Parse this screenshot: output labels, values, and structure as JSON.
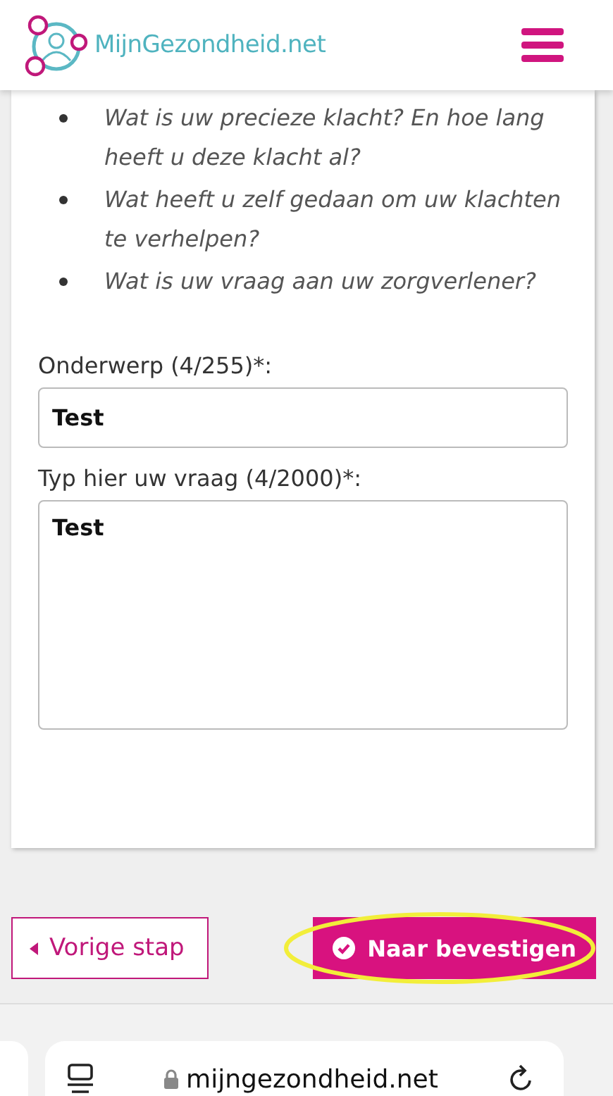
{
  "header": {
    "logo_text": "MijnGezondheid.net"
  },
  "questions": [
    "Wat is uw precieze klacht? En hoe lang heeft u deze klacht al?",
    "Wat heeft u zelf gedaan om uw klachten te verhelpen?",
    "Wat is uw vraag aan uw zorgverlener?"
  ],
  "form": {
    "subject_label": "Onderwerp (4/255)*:",
    "subject_value": "Test",
    "question_label": "Typ hier uw vraag (4/2000)*:",
    "question_value": "Test"
  },
  "buttons": {
    "back": "Vorige stap",
    "next": "Naar bevestigen"
  },
  "browser": {
    "url": "mijngezondheid.net"
  }
}
